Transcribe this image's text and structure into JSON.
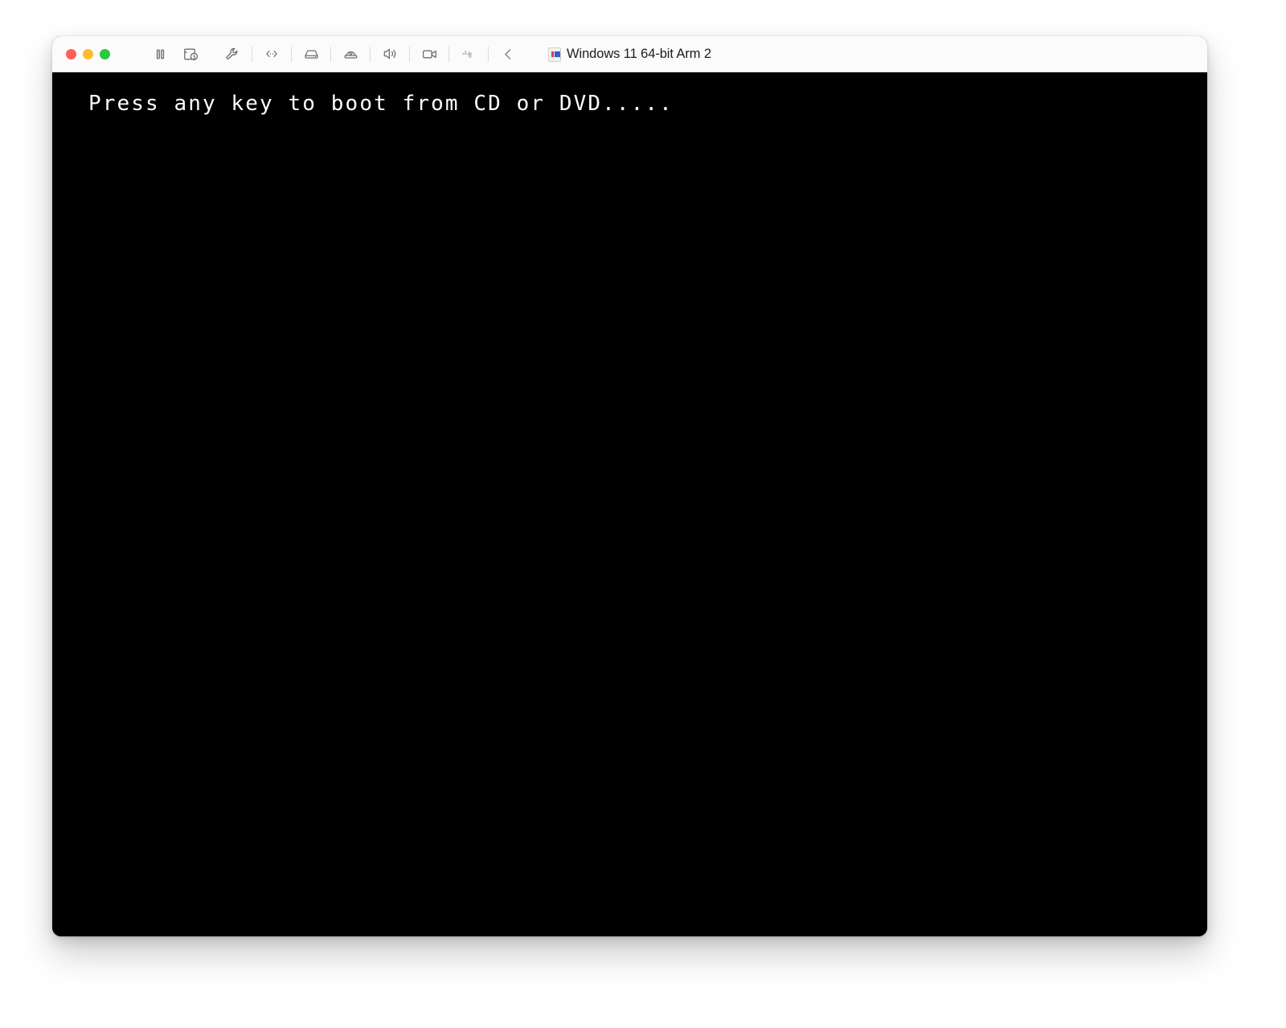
{
  "window": {
    "title": "Windows 11 64-bit Arm 2",
    "title_icon": "vm-document-icon",
    "traffic_lights": [
      {
        "name": "close-button",
        "color": "#ff5f57",
        "label": "Close"
      },
      {
        "name": "minimize-button",
        "color": "#febc2e",
        "label": "Minimize"
      },
      {
        "name": "maximize-button",
        "color": "#28c840",
        "label": "Maximize"
      }
    ]
  },
  "toolbar": {
    "items": [
      {
        "name": "pause-icon",
        "label": "Pause",
        "enabled": true
      },
      {
        "name": "snapshot-clock-icon",
        "label": "Snapshots",
        "enabled": true
      },
      {
        "name": "wrench-icon",
        "label": "Configure",
        "enabled": true
      },
      {
        "name": "network-icon",
        "label": "Network",
        "enabled": true
      },
      {
        "name": "hard-disk-icon",
        "label": "Hard Disk",
        "enabled": true
      },
      {
        "name": "cd-dvd-icon",
        "label": "CD/DVD",
        "enabled": true
      },
      {
        "name": "sound-icon",
        "label": "Sound",
        "enabled": true
      },
      {
        "name": "camera-icon",
        "label": "Camera",
        "enabled": true
      },
      {
        "name": "usb-icon",
        "label": "USB",
        "enabled": false
      },
      {
        "name": "chevron-left-icon",
        "label": "Back",
        "enabled": true
      }
    ]
  },
  "screen": {
    "boot_message": "Press any key to boot from CD or DVD.....",
    "background_color": "#000000",
    "text_color": "#ffffff"
  }
}
